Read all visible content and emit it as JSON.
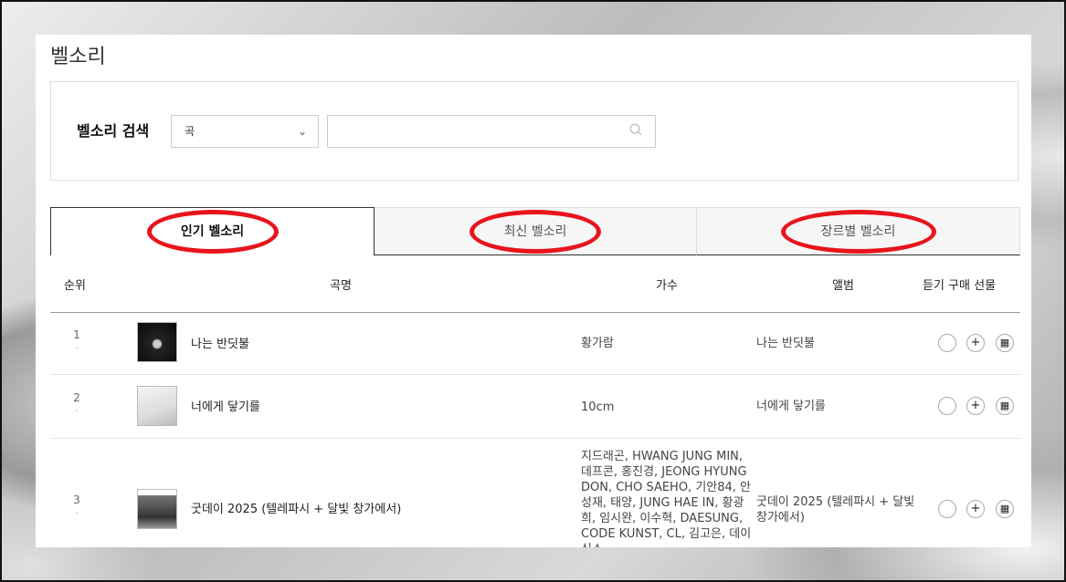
{
  "page": {
    "title": "벨소리"
  },
  "search": {
    "label": "벨소리 검색",
    "select_value": "곡",
    "placeholder": ""
  },
  "tabs": [
    {
      "label": "인기 벨소리",
      "active": true
    },
    {
      "label": "최신 벨소리",
      "active": false
    },
    {
      "label": "장르별 벨소리",
      "active": false
    }
  ],
  "table": {
    "headers": {
      "rank": "순위",
      "song": "곡명",
      "artist": "가수",
      "album": "앨범",
      "actions": "듣기 구매 선물"
    },
    "rows": [
      {
        "rank": "1",
        "change": "-",
        "song": "나는 반딧불",
        "artist": "황가람",
        "album": "나는 반딧불"
      },
      {
        "rank": "2",
        "change": "-",
        "song": "너에게 닿기를",
        "artist": "10cm",
        "album": "너에게 닿기를"
      },
      {
        "rank": "3",
        "change": "-",
        "song": "굿데이 2025 (텔레파시 + 달빛 창가에서)",
        "artist": "지드래곤, HWANG JUNG MIN, 데프콘, 홍진경, JEONG HYUNG DON, CHO SAEHO, 기안84, 안성재, 태양, JUNG HAE IN, 황광희, 임시완, 이수혁, DAESUNG, CODE KUNST, CL, 김고은, 데이식스",
        "album": "굿데이 2025 (텔레파시 + 달빛 창가에서)"
      }
    ]
  },
  "colors": {
    "highlight_ring": "#e8141c",
    "border_dark": "#333333"
  }
}
